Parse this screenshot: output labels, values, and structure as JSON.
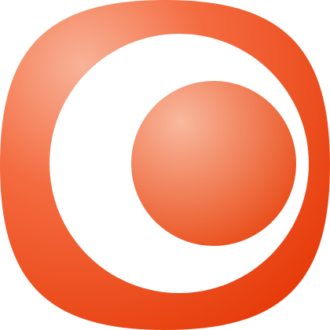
{
  "icon": {
    "name": "app-icon",
    "shape": "rounded-square-with-offset-ring",
    "colors": {
      "background_highlight": "#f8b398",
      "background_mid": "#f46b40",
      "background_dark": "#e63a08",
      "ring": "#ffffff",
      "inner_circle_highlight": "#f9b89e",
      "inner_circle_dark": "#e8440e"
    }
  }
}
